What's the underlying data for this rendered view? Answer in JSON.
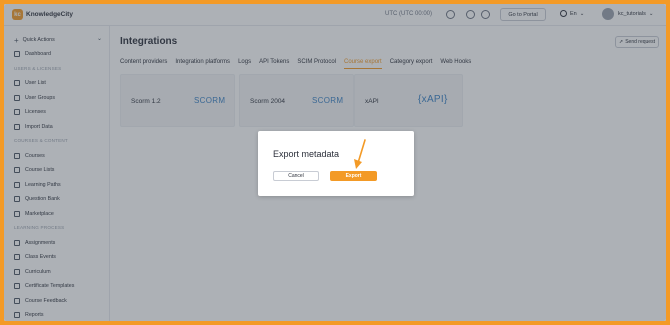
{
  "app": {
    "logo_mark": "kc",
    "logo_text": "KnowledgeCity",
    "timezone": "UTC (UTC 00:00)",
    "portal_button": "Go to Portal",
    "language": "En",
    "language_caret": "⌄",
    "username": "kc_tutorials",
    "user_caret": "⌄"
  },
  "sidebar": {
    "quick_actions": "Quick Actions",
    "dashboard": "Dashboard",
    "section_users": "USERS & LICENSES",
    "users": [
      "User List",
      "User Groups",
      "Licenses",
      "Import Data"
    ],
    "section_courses": "COURSES & CONTENT",
    "courses": [
      "Courses",
      "Course Lists",
      "Learning Paths",
      "Question Bank",
      "Marketplace"
    ],
    "section_learning": "LEARNING PROCESS",
    "learning": [
      "Assignments",
      "Class Events",
      "Curriculum",
      "Certificate Templates",
      "Course Feedback",
      "Reports"
    ]
  },
  "main": {
    "title": "Integrations",
    "send_request": "Send request",
    "tabs": [
      "Content providers",
      "Integration platforms",
      "Logs",
      "API Tokens",
      "SCIM Protocol",
      "Course export",
      "Category export",
      "Web Hooks"
    ],
    "active_tab": "Course export",
    "cards": [
      {
        "label": "Scorm 1.2",
        "logo": "SCORM"
      },
      {
        "label": "Scorm 2004",
        "logo": "SCORM"
      },
      {
        "label": "xAPI",
        "logo": "{xAPI}"
      }
    ]
  },
  "modal": {
    "title": "Export metadata",
    "cancel": "Cancel",
    "export": "Export"
  },
  "colors": {
    "accent": "#f39a26",
    "logo_blue": "#3b82c4"
  }
}
